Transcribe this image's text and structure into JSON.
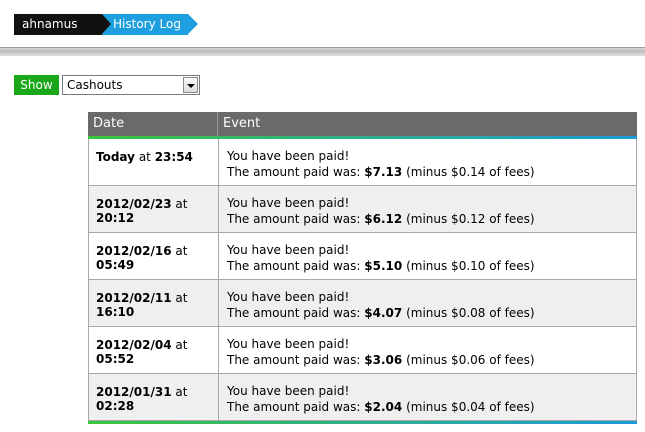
{
  "breadcrumb": {
    "user": "ahnamus",
    "page": "History Log"
  },
  "filter": {
    "show_label": "Show",
    "selected": "Cashouts"
  },
  "table": {
    "headers": {
      "date": "Date",
      "event": "Event"
    },
    "rows": [
      {
        "date": "Today",
        "at": "at",
        "time": "23:54",
        "line1": "You have been paid!",
        "line2_prefix": "The amount paid was:",
        "amount": "$7.13",
        "fee": "(minus $0.14 of fees)"
      },
      {
        "date": "2012/02/23",
        "at": "at",
        "time": "20:12",
        "line1": "You have been paid!",
        "line2_prefix": "The amount paid was:",
        "amount": "$6.12",
        "fee": "(minus $0.12 of fees)"
      },
      {
        "date": "2012/02/16",
        "at": "at",
        "time": "05:49",
        "line1": "You have been paid!",
        "line2_prefix": "The amount paid was:",
        "amount": "$5.10",
        "fee": "(minus $0.10 of fees)"
      },
      {
        "date": "2012/02/11",
        "at": "at",
        "time": "16:10",
        "line1": "You have been paid!",
        "line2_prefix": "The amount paid was:",
        "amount": "$4.07",
        "fee": "(minus $0.08 of fees)"
      },
      {
        "date": "2012/02/04",
        "at": "at",
        "time": "05:52",
        "line1": "You have been paid!",
        "line2_prefix": "The amount paid was:",
        "amount": "$3.06",
        "fee": "(minus $0.06 of fees)"
      },
      {
        "date": "2012/01/31",
        "at": "at",
        "time": "02:28",
        "line1": "You have been paid!",
        "line2_prefix": "The amount paid was:",
        "amount": "$2.04",
        "fee": "(minus $0.04 of fees)"
      }
    ]
  },
  "colors": {
    "show_green": "#1aa71a",
    "crumb_blue": "#1ea0e0",
    "header_gray": "#6a6a6a"
  }
}
